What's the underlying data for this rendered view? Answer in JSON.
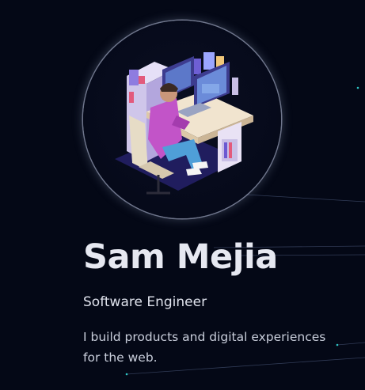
{
  "profile": {
    "name": "Sam Mejia",
    "role": "Software Engineer",
    "bio": "I build products and digital experiences for the web.",
    "avatar_icon": "developer-at-desk-illustration"
  },
  "theme": {
    "background": "#040816",
    "accent_dot": "#2ec4c4",
    "text_primary": "#e6e8f1",
    "text_secondary": "#c9cedb"
  }
}
